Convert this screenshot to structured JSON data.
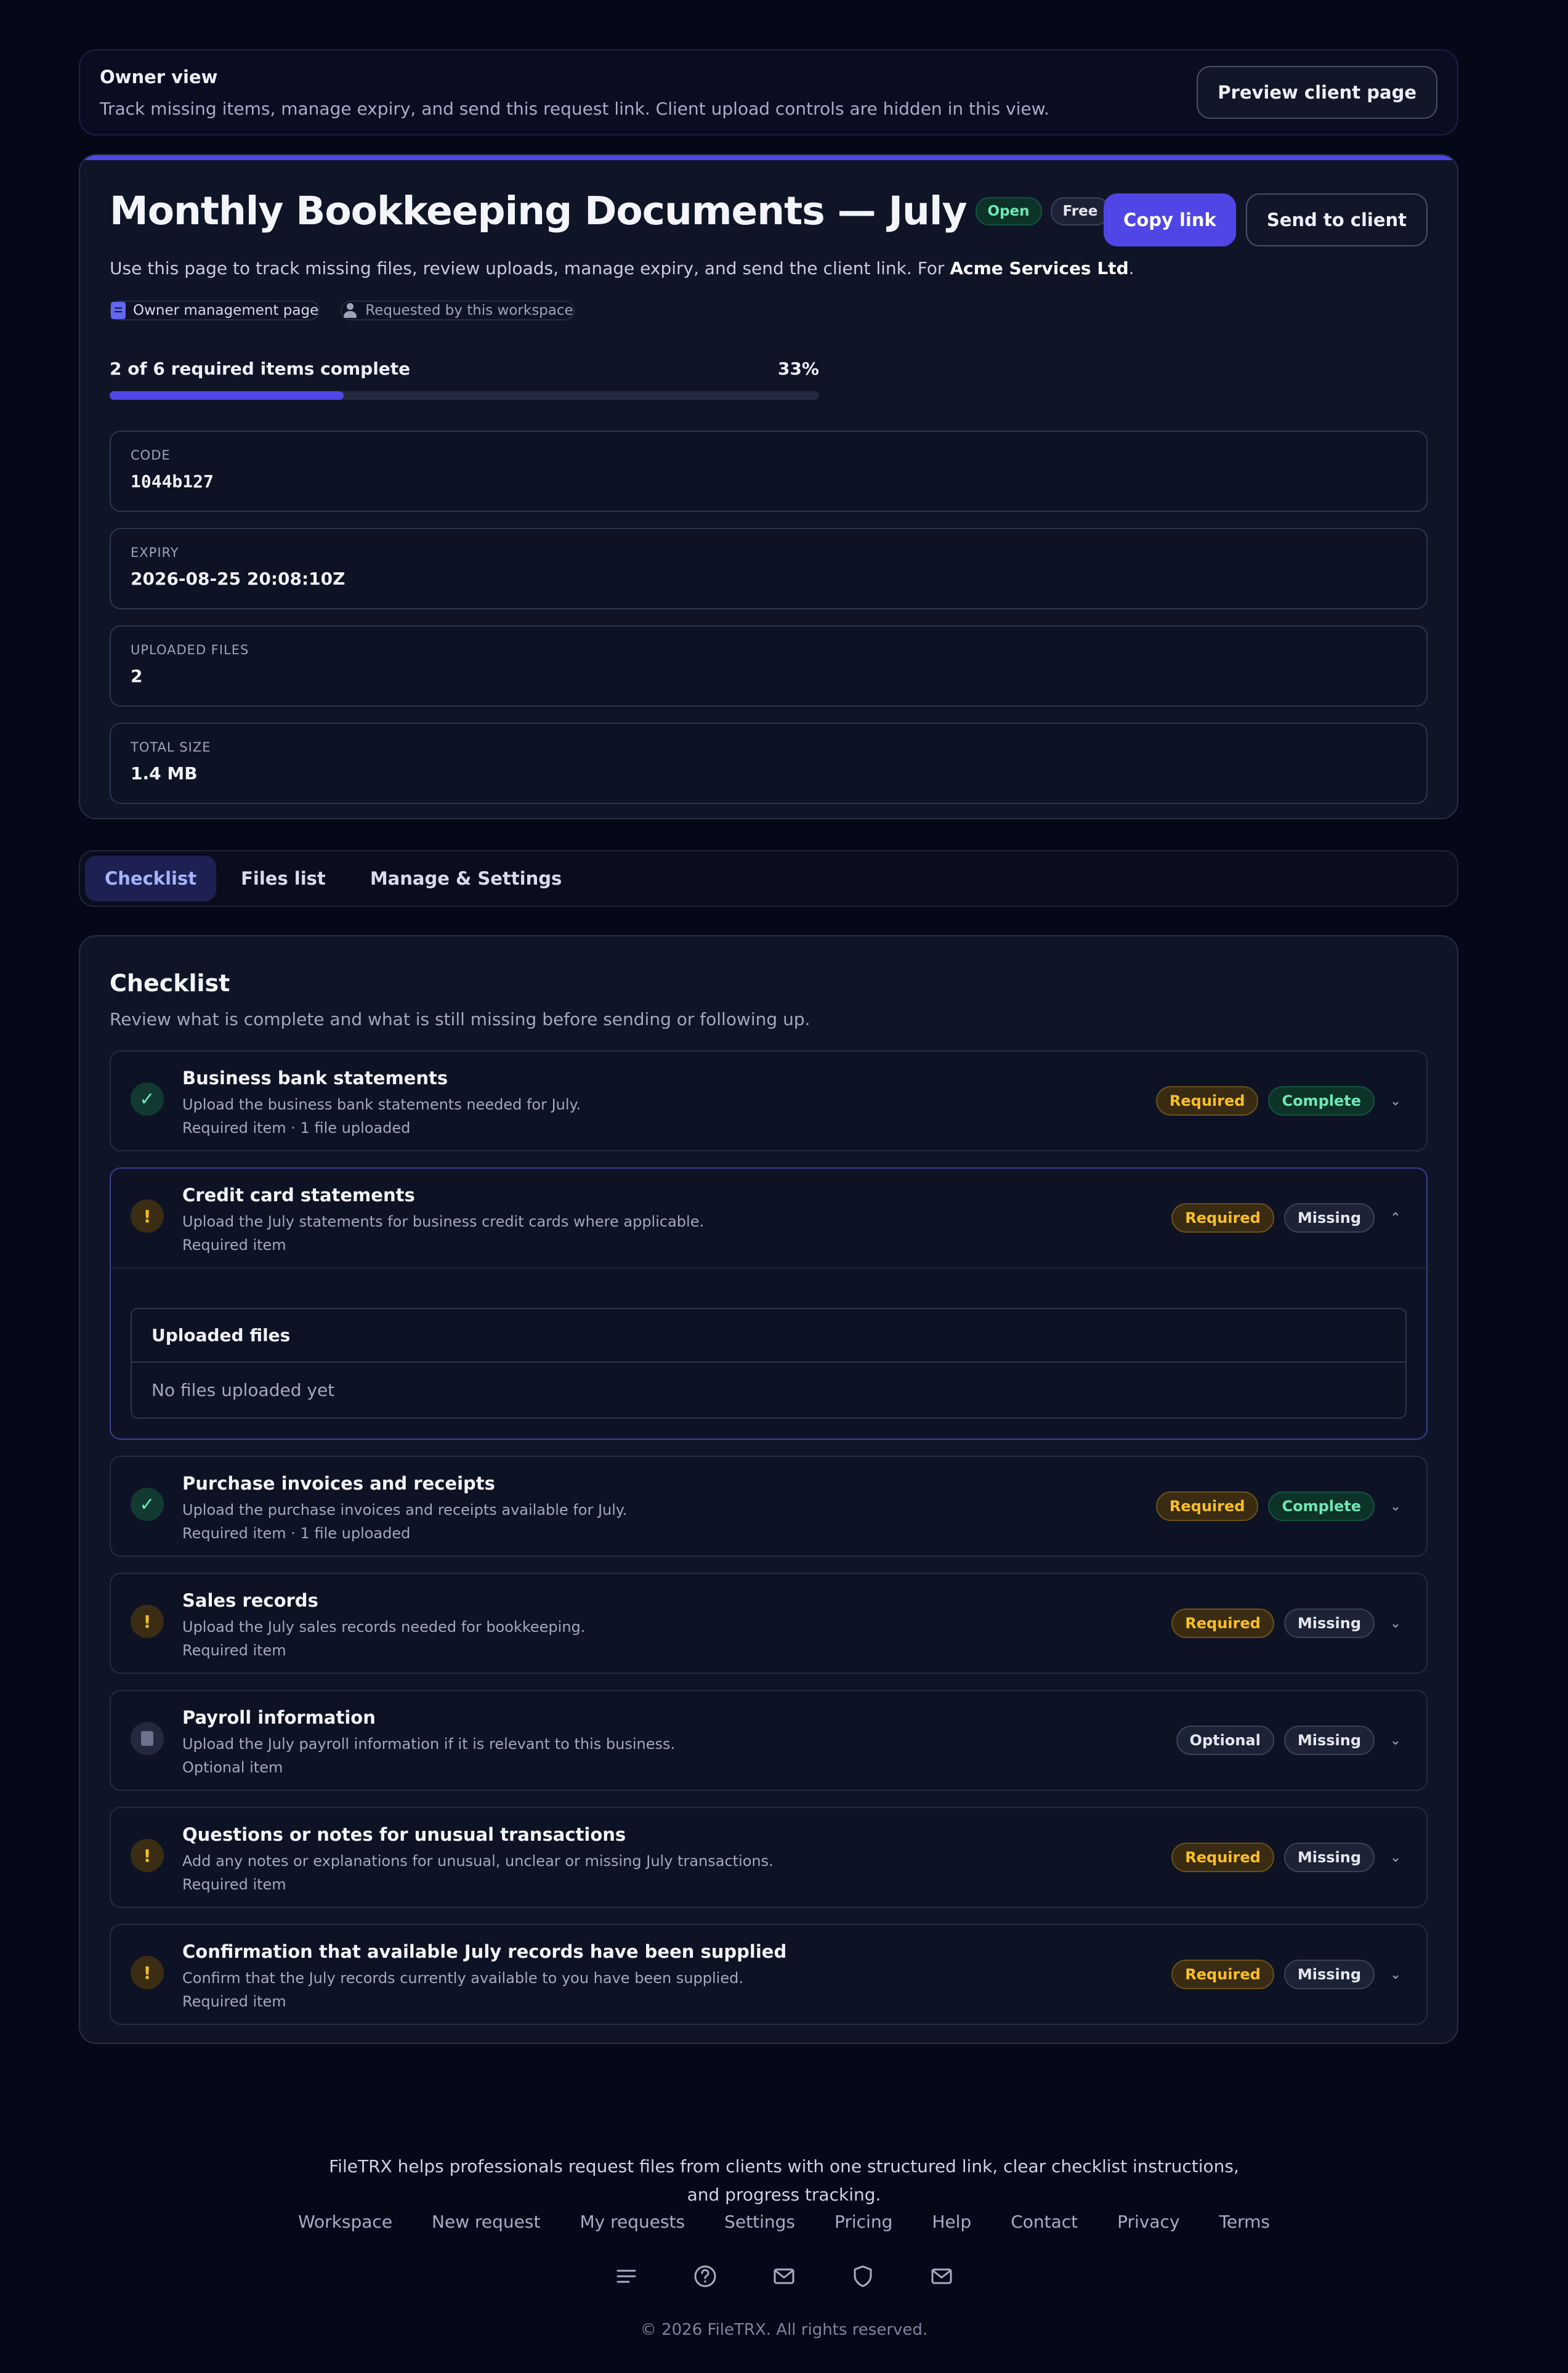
{
  "banner": {
    "title": "Owner view",
    "text": "Track missing items, manage expiry, and send this request link. Client upload controls are hidden in this view.",
    "preview_button": "Preview client page"
  },
  "request": {
    "title": "Monthly Bookkeeping Documents — July",
    "status_badge": "Open",
    "plan_badge": "Free",
    "copy_button": "Copy link",
    "send_button": "Send to client",
    "description": "Use this page to track missing files, review uploads, manage expiry, and send the client link.",
    "for_label": "For",
    "client": "Acme Services Ltd",
    "meta_page": "Owner management page",
    "meta_requested": "Requested by this workspace",
    "progress_text": "2 of 6 required items complete",
    "progress_percent_label": "33%",
    "progress_fraction": 0.33
  },
  "stats": [
    {
      "label": "CODE",
      "value": "1044b127"
    },
    {
      "label": "EXPIRY",
      "value": "2026-08-25 20:08:10Z"
    },
    {
      "label": "UPLOADED FILES",
      "value": "2"
    },
    {
      "label": "TOTAL SIZE",
      "value": "1.4 MB"
    }
  ],
  "tabs": [
    "Checklist",
    "Files list",
    "Manage & Settings"
  ],
  "checklist": {
    "title": "Checklist",
    "subtitle": "Review what is complete and what is still missing before sending or following up.",
    "items": [
      {
        "title": "Business bank statements",
        "desc": "Upload the business bank statements needed for July.",
        "note": "Required item · 1 file uploaded",
        "req": "Required",
        "status": "Complete"
      },
      {
        "title": "Credit card statements",
        "desc": "Upload the July statements for business credit cards where applicable.",
        "note": "Required item",
        "req": "Required",
        "status": "Missing",
        "uploaded_title": "Uploaded files",
        "uploaded_empty": "No files uploaded yet"
      },
      {
        "title": "Purchase invoices and receipts",
        "desc": "Upload the purchase invoices and receipts available for July.",
        "note": "Required item · 1 file uploaded",
        "req": "Required",
        "status": "Complete"
      },
      {
        "title": "Sales records",
        "desc": "Upload the July sales records needed for bookkeeping.",
        "note": "Required item",
        "req": "Required",
        "status": "Missing"
      },
      {
        "title": "Payroll information",
        "desc": "Upload the July payroll information if it is relevant to this business.",
        "note": "Optional item",
        "req": "Optional",
        "status": "Missing"
      },
      {
        "title": "Questions or notes for unusual transactions",
        "desc": "Add any notes or explanations for unusual, unclear or missing July transactions.",
        "note": "Required item",
        "req": "Required",
        "status": "Missing"
      },
      {
        "title": "Confirmation that available July records have been supplied",
        "desc": "Confirm that the July records currently available to you have been supplied.",
        "note": "Required item",
        "req": "Required",
        "status": "Missing"
      }
    ]
  },
  "footer": {
    "text": "FileTRX helps professionals request files from clients with one structured link, clear checklist instructions, and progress tracking.",
    "links": [
      "Workspace",
      "New request",
      "My requests",
      "Settings",
      "Pricing",
      "Help",
      "Contact",
      "Privacy",
      "Terms"
    ],
    "icons": [
      "menu-icon",
      "help-icon",
      "mail-icon",
      "shield-icon",
      "mail-icon"
    ],
    "copyright": "© 2026 FileTRX. All rights reserved."
  },
  "colors": {
    "accent": "#4f46e5",
    "complete": "#6ee7b7",
    "required": "#fbbf24",
    "background": "#050816"
  }
}
